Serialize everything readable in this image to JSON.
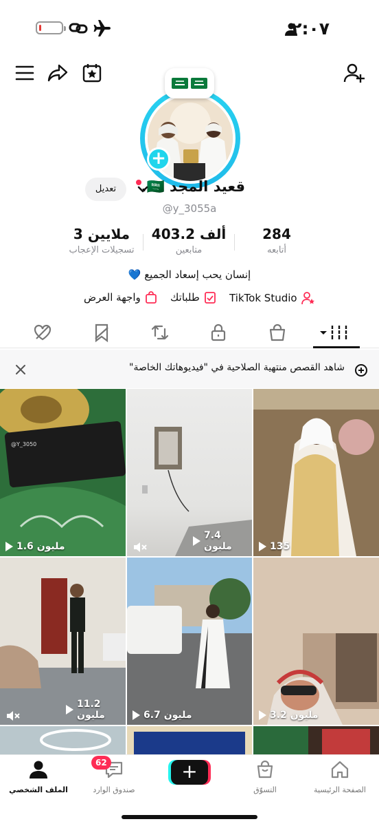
{
  "status_bar": {
    "time": "٢:٠٧",
    "icons": [
      "person-icon",
      "airplane-icon",
      "link-icon",
      "battery-icon"
    ]
  },
  "profile": {
    "name": "قعيد المجد 🇸🇦.",
    "handle": "@y_3055a",
    "edit_label": "تعديل",
    "stats": [
      {
        "value": "284",
        "label": "أتابعه"
      },
      {
        "value": "403.2 ألف",
        "label": "متابعين"
      },
      {
        "value": "3 ملايين",
        "label": "تسجيلات الإعجاب"
      }
    ],
    "bio": "إنسان يحب إسعاد الجميع 💙",
    "links": {
      "tiktok_studio": "TikTok Studio",
      "orders": "طلباتك",
      "showcase": "واجهة العرض"
    }
  },
  "banner": {
    "text": "شاهد القصص منتهية الصلاحية في \"فيديوهاتك الخاصة\""
  },
  "videos": [
    {
      "views": "1.6 مليون",
      "image_text": "@Y_3050"
    },
    {
      "views": "7.4 مليون"
    },
    {
      "views": "135"
    },
    {
      "views": "11.2 مليون"
    },
    {
      "views": "6.7 مليون"
    },
    {
      "views": "3.2 مليون"
    }
  ],
  "nav": {
    "home": "الصفحة الرئيسية",
    "shop": "التسوّق",
    "inbox": "صندوق الوارد",
    "inbox_badge": "62",
    "profile": "الملف الشخصي"
  },
  "colors": {
    "accent_cyan": "#20d5ec",
    "tiktok_red": "#fe2c55",
    "text_gray": "#8a8b91"
  }
}
